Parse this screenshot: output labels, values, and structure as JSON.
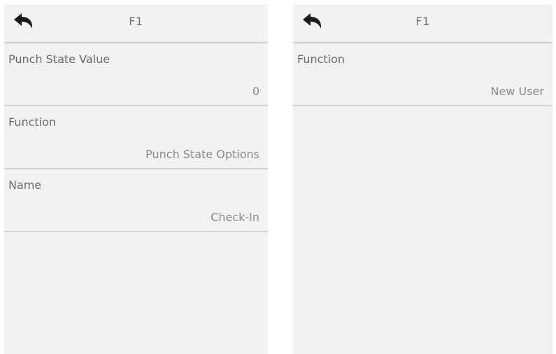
{
  "left_screen": {
    "title": "F1",
    "rows": [
      {
        "label": "Punch State Value",
        "value": "0"
      },
      {
        "label": "Function",
        "value": "Punch State Options"
      },
      {
        "label": "Name",
        "value": "Check-In"
      }
    ]
  },
  "right_screen": {
    "title": "F1",
    "rows": [
      {
        "label": "Function",
        "value": "New User"
      }
    ]
  },
  "icons": {
    "back": "back-arrow-icon"
  },
  "colors": {
    "screen_background": "#f2f2f2",
    "divider": "#d2d2d2",
    "label_text": "#6a6a6a",
    "value_text": "#8a8a8a",
    "icon": "#1a1a1a"
  }
}
